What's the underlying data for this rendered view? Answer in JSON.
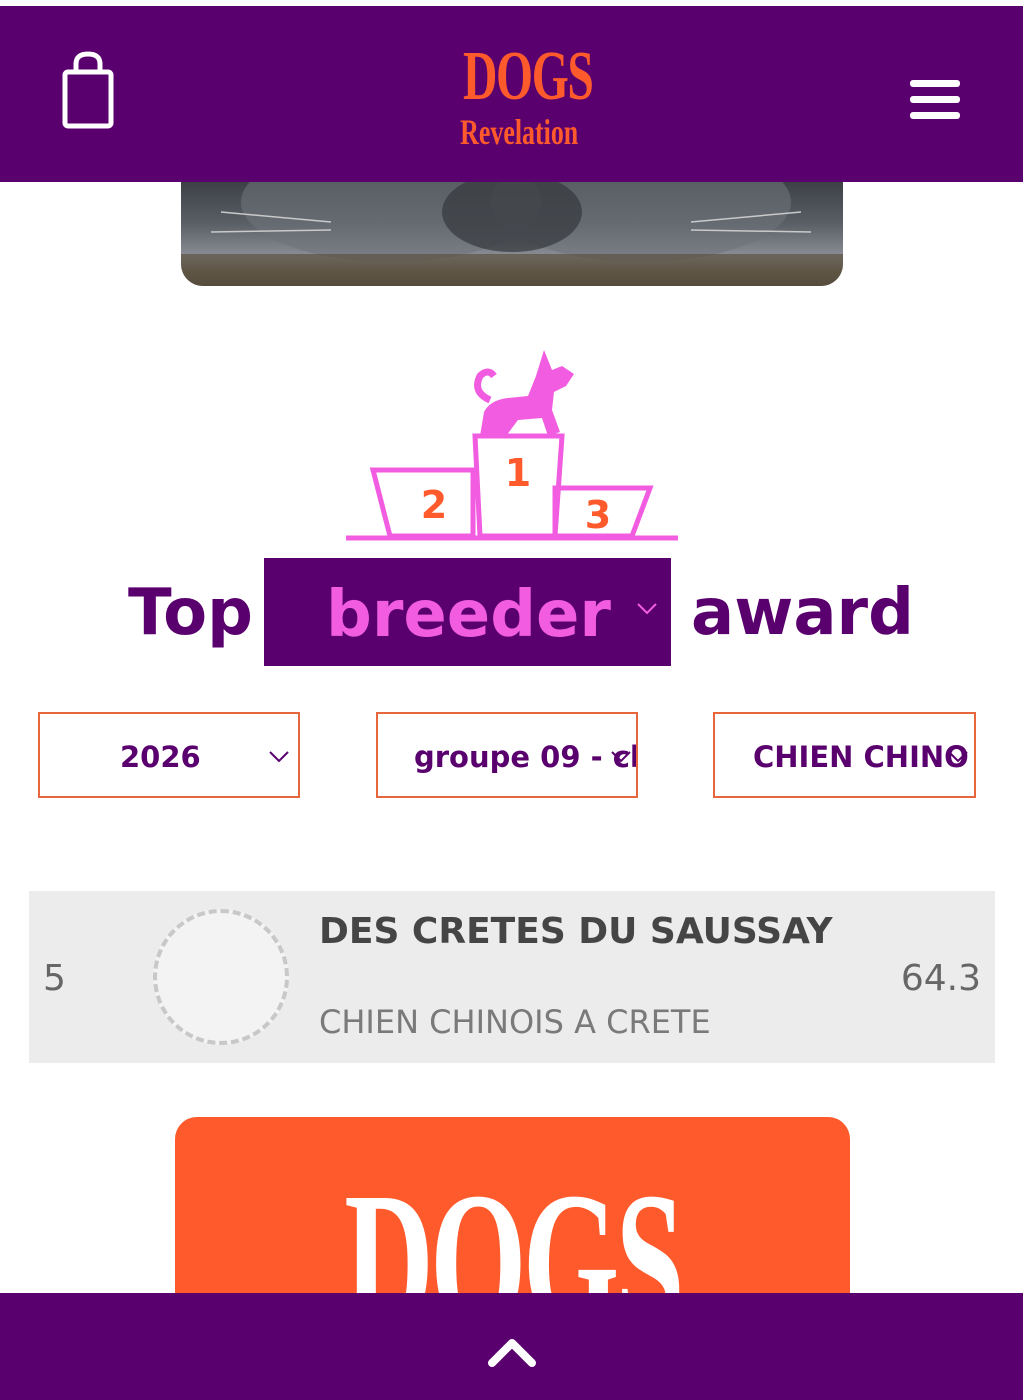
{
  "header": {
    "logo_top": "DOGS",
    "logo_bottom": "Revelation",
    "cart_icon": "shopping-bag-icon",
    "menu_icon": "hamburger-menu-icon"
  },
  "podium": {
    "first": "1",
    "second": "2",
    "third": "3"
  },
  "headline": {
    "prefix": "Top",
    "selected": "breeder",
    "suffix": "award"
  },
  "filters": {
    "year": "2026",
    "group": "groupe 09 - cl",
    "breed": "CHIEN CHINO"
  },
  "results": [
    {
      "rank": "5",
      "name": "DES CRETES DU SAUSSAY",
      "breed": "CHIEN CHINOIS A CRETE",
      "score": "64.3"
    }
  ],
  "promo": {
    "logo_text": "DOGS"
  },
  "colors": {
    "brand_purple": "#5a006e",
    "brand_orange": "#ff5a2c",
    "brand_pink": "#f15ce0"
  }
}
